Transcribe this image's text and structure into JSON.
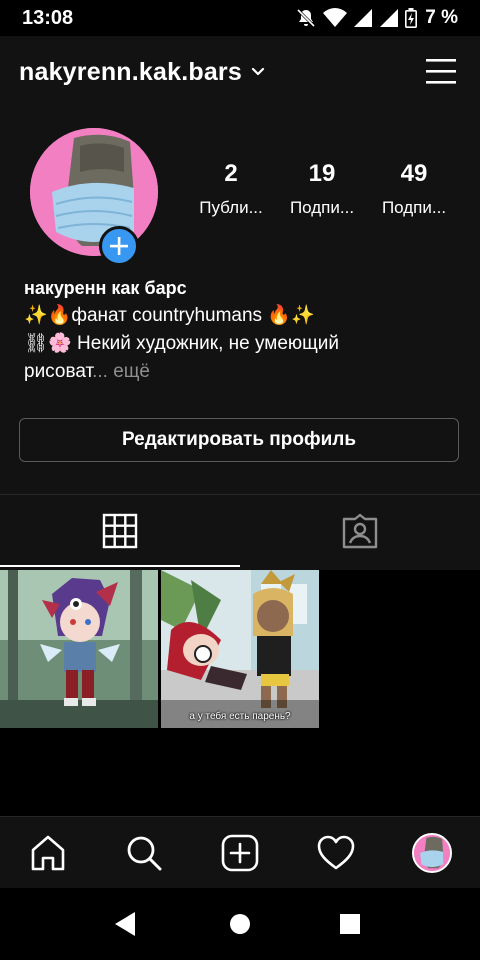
{
  "status_bar": {
    "time": "13:08",
    "battery_text": "7 %",
    "icons": [
      "mute-icon",
      "wifi-icon",
      "signal-icon",
      "signal-icon",
      "battery-icon"
    ]
  },
  "header": {
    "username": "nakyrenn.kak.bars",
    "icons": [
      "chevron-down-icon",
      "menu-icon"
    ]
  },
  "profile": {
    "stats": [
      {
        "count": "2",
        "label": "Публи..."
      },
      {
        "count": "19",
        "label": "Подпи..."
      },
      {
        "count": "49",
        "label": "Подпи..."
      }
    ],
    "name": "накуренн как барс",
    "bio_line1": "✨🔥фанат countryhumans 🔥✨",
    "bio_line2": "⛓🌸 Некий художник, не умеющий",
    "bio_line3": "рисоват",
    "bio_more": "... ещё"
  },
  "edit_profile_label": "Редактировать профиль",
  "tabs": [
    {
      "icon": "grid-icon",
      "active": true
    },
    {
      "icon": "tagged-icon",
      "active": false
    }
  ],
  "posts": [
    {
      "caption": ""
    },
    {
      "caption": "а у тебя есть парень?"
    }
  ],
  "bottom_nav": [
    "home-icon",
    "search-icon",
    "add-post-icon",
    "activity-heart-icon",
    "profile-avatar"
  ],
  "system_nav": [
    "back-icon",
    "home-circle-icon",
    "recents-icon"
  ],
  "colors": {
    "background": "#121212",
    "accent": "#3897f0",
    "avatar_bg": "#f27fc2",
    "muted_text": "#8e8e8e"
  }
}
